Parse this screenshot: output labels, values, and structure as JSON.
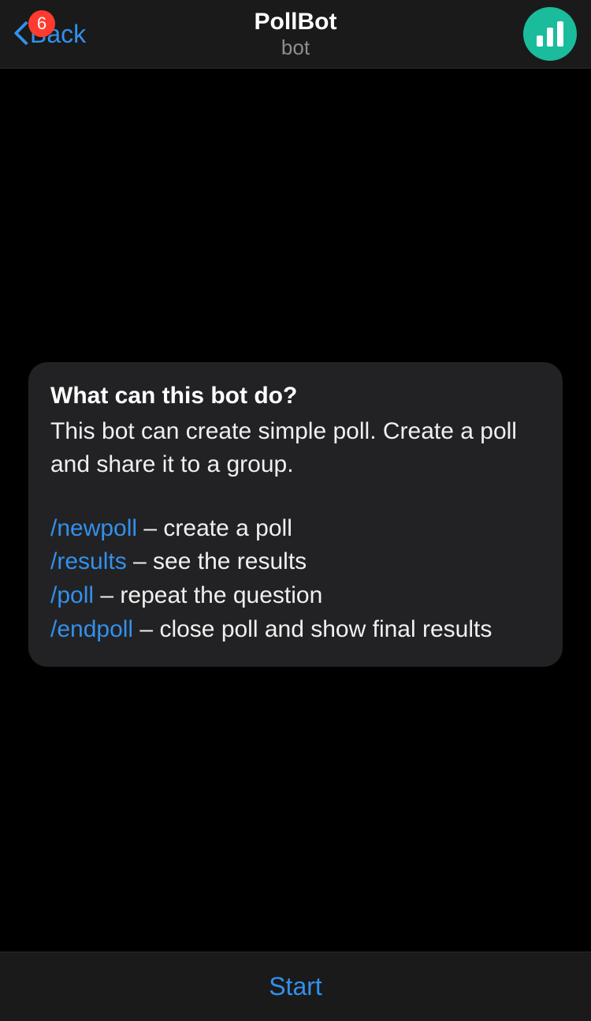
{
  "header": {
    "back_label": "Back",
    "badge_count": "6",
    "title": "PollBot",
    "subtitle": "bot"
  },
  "intro": {
    "title": "What can this bot do?",
    "description": "This bot can create simple poll. Create a poll and share it to a group.",
    "commands": [
      {
        "name": "/newpoll",
        "desc": " – create a poll"
      },
      {
        "name": "/results",
        "desc": " – see the results"
      },
      {
        "name": "/poll",
        "desc": " – repeat the question"
      },
      {
        "name": "/endpoll",
        "desc": " – close poll and show final results"
      }
    ]
  },
  "bottom": {
    "start_label": "Start"
  },
  "icons": {
    "back_chevron": "chevron-left-icon",
    "avatar_bars": "bars-icon"
  }
}
